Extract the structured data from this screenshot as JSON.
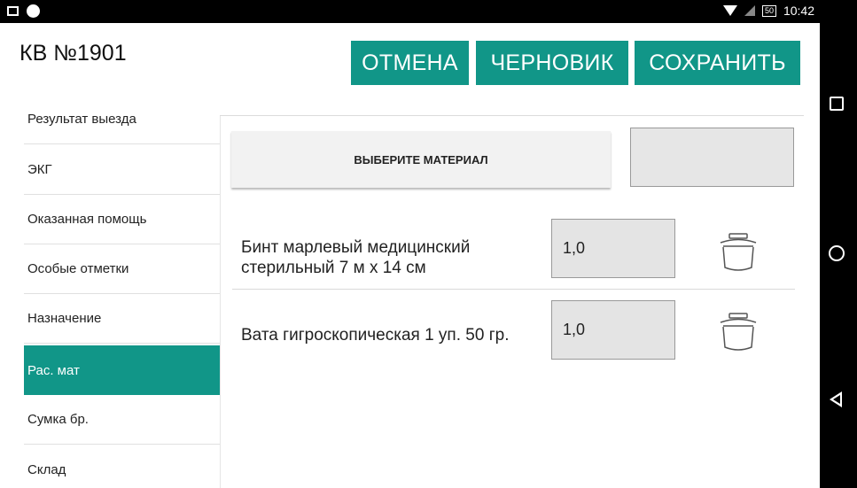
{
  "status_bar": {
    "time": "10:42",
    "battery": "50"
  },
  "header": {
    "title": "КВ №1901",
    "cancel_label": "ОТМЕНА",
    "draft_label": "ЧЕРНОВИК",
    "save_label": "СОХРАНИТЬ"
  },
  "sidebar": {
    "items": [
      {
        "label": "Результат выезда"
      },
      {
        "label": "ЭКГ"
      },
      {
        "label": "Оказанная помощь"
      },
      {
        "label": "Особые отметки"
      },
      {
        "label": "Назначение"
      },
      {
        "label": "Рас. мат"
      },
      {
        "label": "Сумка бр."
      },
      {
        "label": "Склад"
      }
    ],
    "active_index": 5
  },
  "main": {
    "choose_material_label": "ВЫБЕРИТЕ МАТЕРИАЛ",
    "materials": [
      {
        "name_line1": "Бинт марлевый медицинский",
        "name_line2": "стерильный 7 м х 14 см",
        "quantity": "1,0"
      },
      {
        "name_line1": "Вата гигроскопическая 1 уп. 50 гр.",
        "name_line2": "",
        "quantity": "1,0"
      }
    ]
  },
  "colors": {
    "accent": "#119688",
    "field_bg": "#e4e4e4"
  },
  "icons": [
    "trash-icon",
    "wifi-icon",
    "signal-icon",
    "battery-icon",
    "recent-apps-icon",
    "home-icon",
    "back-icon"
  ]
}
